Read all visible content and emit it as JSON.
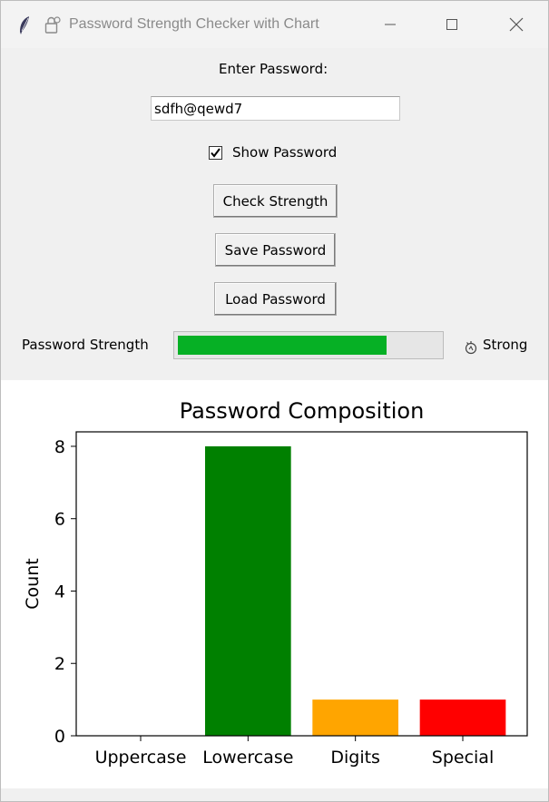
{
  "window": {
    "title": "Password Strength Checker with Chart"
  },
  "form": {
    "enter_label": "Enter Password:",
    "password_value": "sdfh@qewd7",
    "show_password_label": "Show Password",
    "show_password_checked": true,
    "check_button": "Check Strength",
    "save_button": "Save Password",
    "load_button": "Load Password",
    "strength_label": "Password Strength",
    "strength_percent": 80,
    "strength_text": "Strong",
    "strength_color": "#06b025"
  },
  "chart_data": {
    "type": "bar",
    "title": "Password Composition",
    "xlabel": "",
    "ylabel": "Count",
    "categories": [
      "Uppercase",
      "Lowercase",
      "Digits",
      "Special"
    ],
    "values": [
      0,
      8,
      1,
      1
    ],
    "colors": [
      "#0000ff",
      "#008000",
      "#ffa500",
      "#ff0000"
    ],
    "ylim": [
      0,
      8.4
    ],
    "yticks": [
      0,
      2,
      4,
      6,
      8
    ],
    "grid": false
  }
}
